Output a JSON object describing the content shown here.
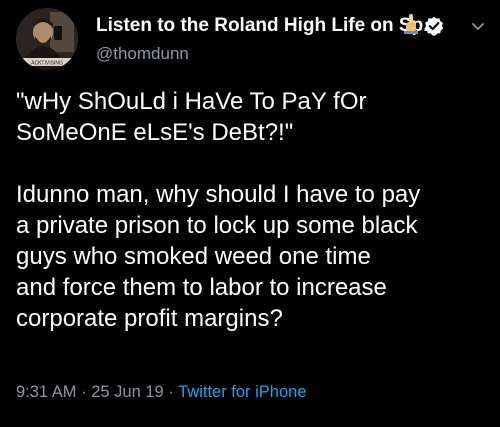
{
  "user": {
    "display_name": "Listen to the Roland High Life on Sp...",
    "emoji_icon": "hand-pointing-icon",
    "verified_icon": "verified-badge-icon",
    "handle": "@thomdunn",
    "avatar_caption": "ACKTIVISING"
  },
  "tweet": {
    "paragraphs": [
      "\"wHy ShOuLd i HaVe To PaY fOr\nSoMeOnE eLsE's DeBt?!\"",
      "Idunno man, why should I have to pay\na private prison to lock up some black\nguys who smoked weed one time\nand force them to labor to increase\ncorporate profit margins?"
    ],
    "time": "9:31 AM",
    "separator": "·",
    "date": "25 Jun 19",
    "source": "Twitter for iPhone"
  },
  "colors": {
    "background": "#000000",
    "text": "#ffffff",
    "secondary": "#8899a6",
    "accent": "#1da1f2"
  },
  "menu_icon": "chevron-down-icon"
}
